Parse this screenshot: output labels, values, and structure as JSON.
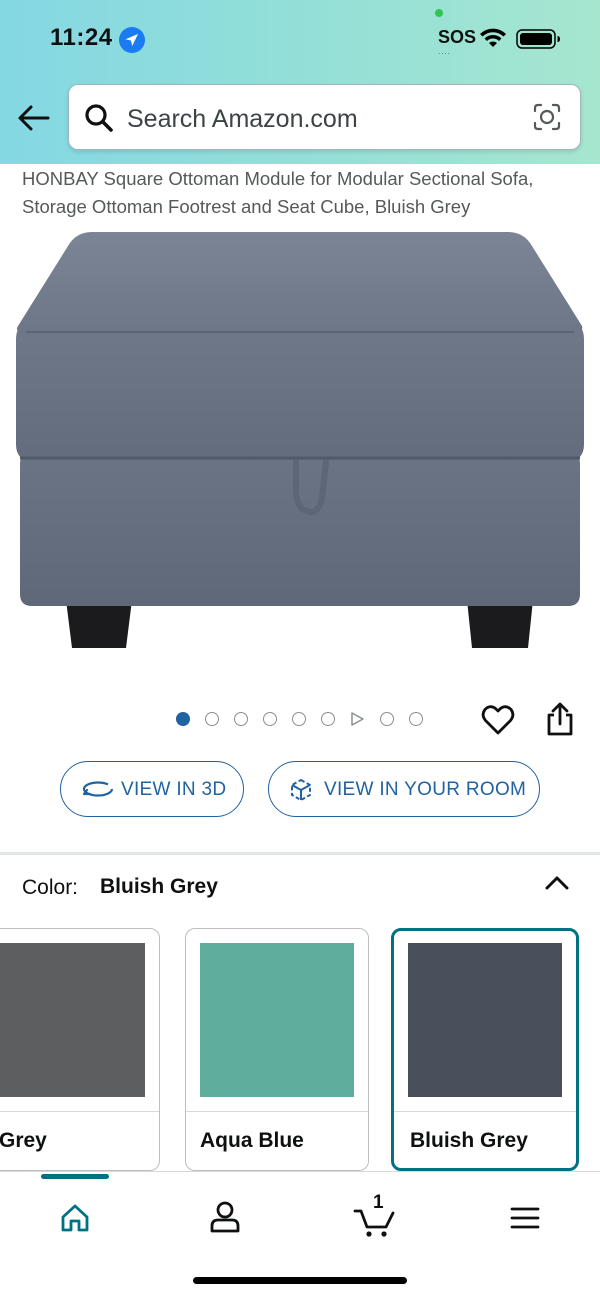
{
  "status_bar": {
    "time": "11:24",
    "sos_label": "SOS",
    "sos_dots": "....",
    "icons": [
      "location-arrow-icon",
      "wifi-icon",
      "battery-icon"
    ]
  },
  "header": {
    "back_icon": "arrow-left-icon",
    "search": {
      "placeholder": "Search Amazon.com",
      "icon": "search-icon",
      "camera_icon": "lens-camera-icon"
    },
    "gradient_colors": [
      "#84d8e3",
      "#a6e6cf"
    ]
  },
  "product": {
    "title": "HONBAY Square Ottoman Module for Modular Sectional Sofa, Storage Ottoman Footrest and Seat Cube, Bluish Grey",
    "image_description_icon": "ottoman-image",
    "carousel": {
      "total": 9,
      "active_index": 0,
      "video_index": 6
    },
    "actions": {
      "wishlist_icon": "heart-icon",
      "share_icon": "share-icon"
    },
    "buttons": {
      "view_3d": "VIEW IN 3D",
      "view_room": "VIEW IN YOUR ROOM"
    }
  },
  "color_selector": {
    "label": "Color:",
    "selected": "Bluish Grey",
    "collapse_icon": "chevron-up-icon",
    "options": [
      {
        "name": "Grey",
        "color": "#5d5e60",
        "selected": false
      },
      {
        "name": "Aqua Blue",
        "color": "#5fad9c",
        "selected": false
      },
      {
        "name": "Bluish Grey",
        "color": "#4a4f5c",
        "selected": true
      }
    ]
  },
  "bottom_nav": {
    "items": [
      {
        "name": "home",
        "icon": "home-icon",
        "active": true
      },
      {
        "name": "account",
        "icon": "person-icon",
        "active": false
      },
      {
        "name": "cart",
        "icon": "cart-icon",
        "count": "1",
        "active": false
      },
      {
        "name": "menu",
        "icon": "hamburger-menu-icon",
        "active": false
      }
    ],
    "accent": "#007185"
  },
  "colors": {
    "link_blue": "#2162a1",
    "teal": "#007185",
    "text_secondary": "#565959"
  }
}
